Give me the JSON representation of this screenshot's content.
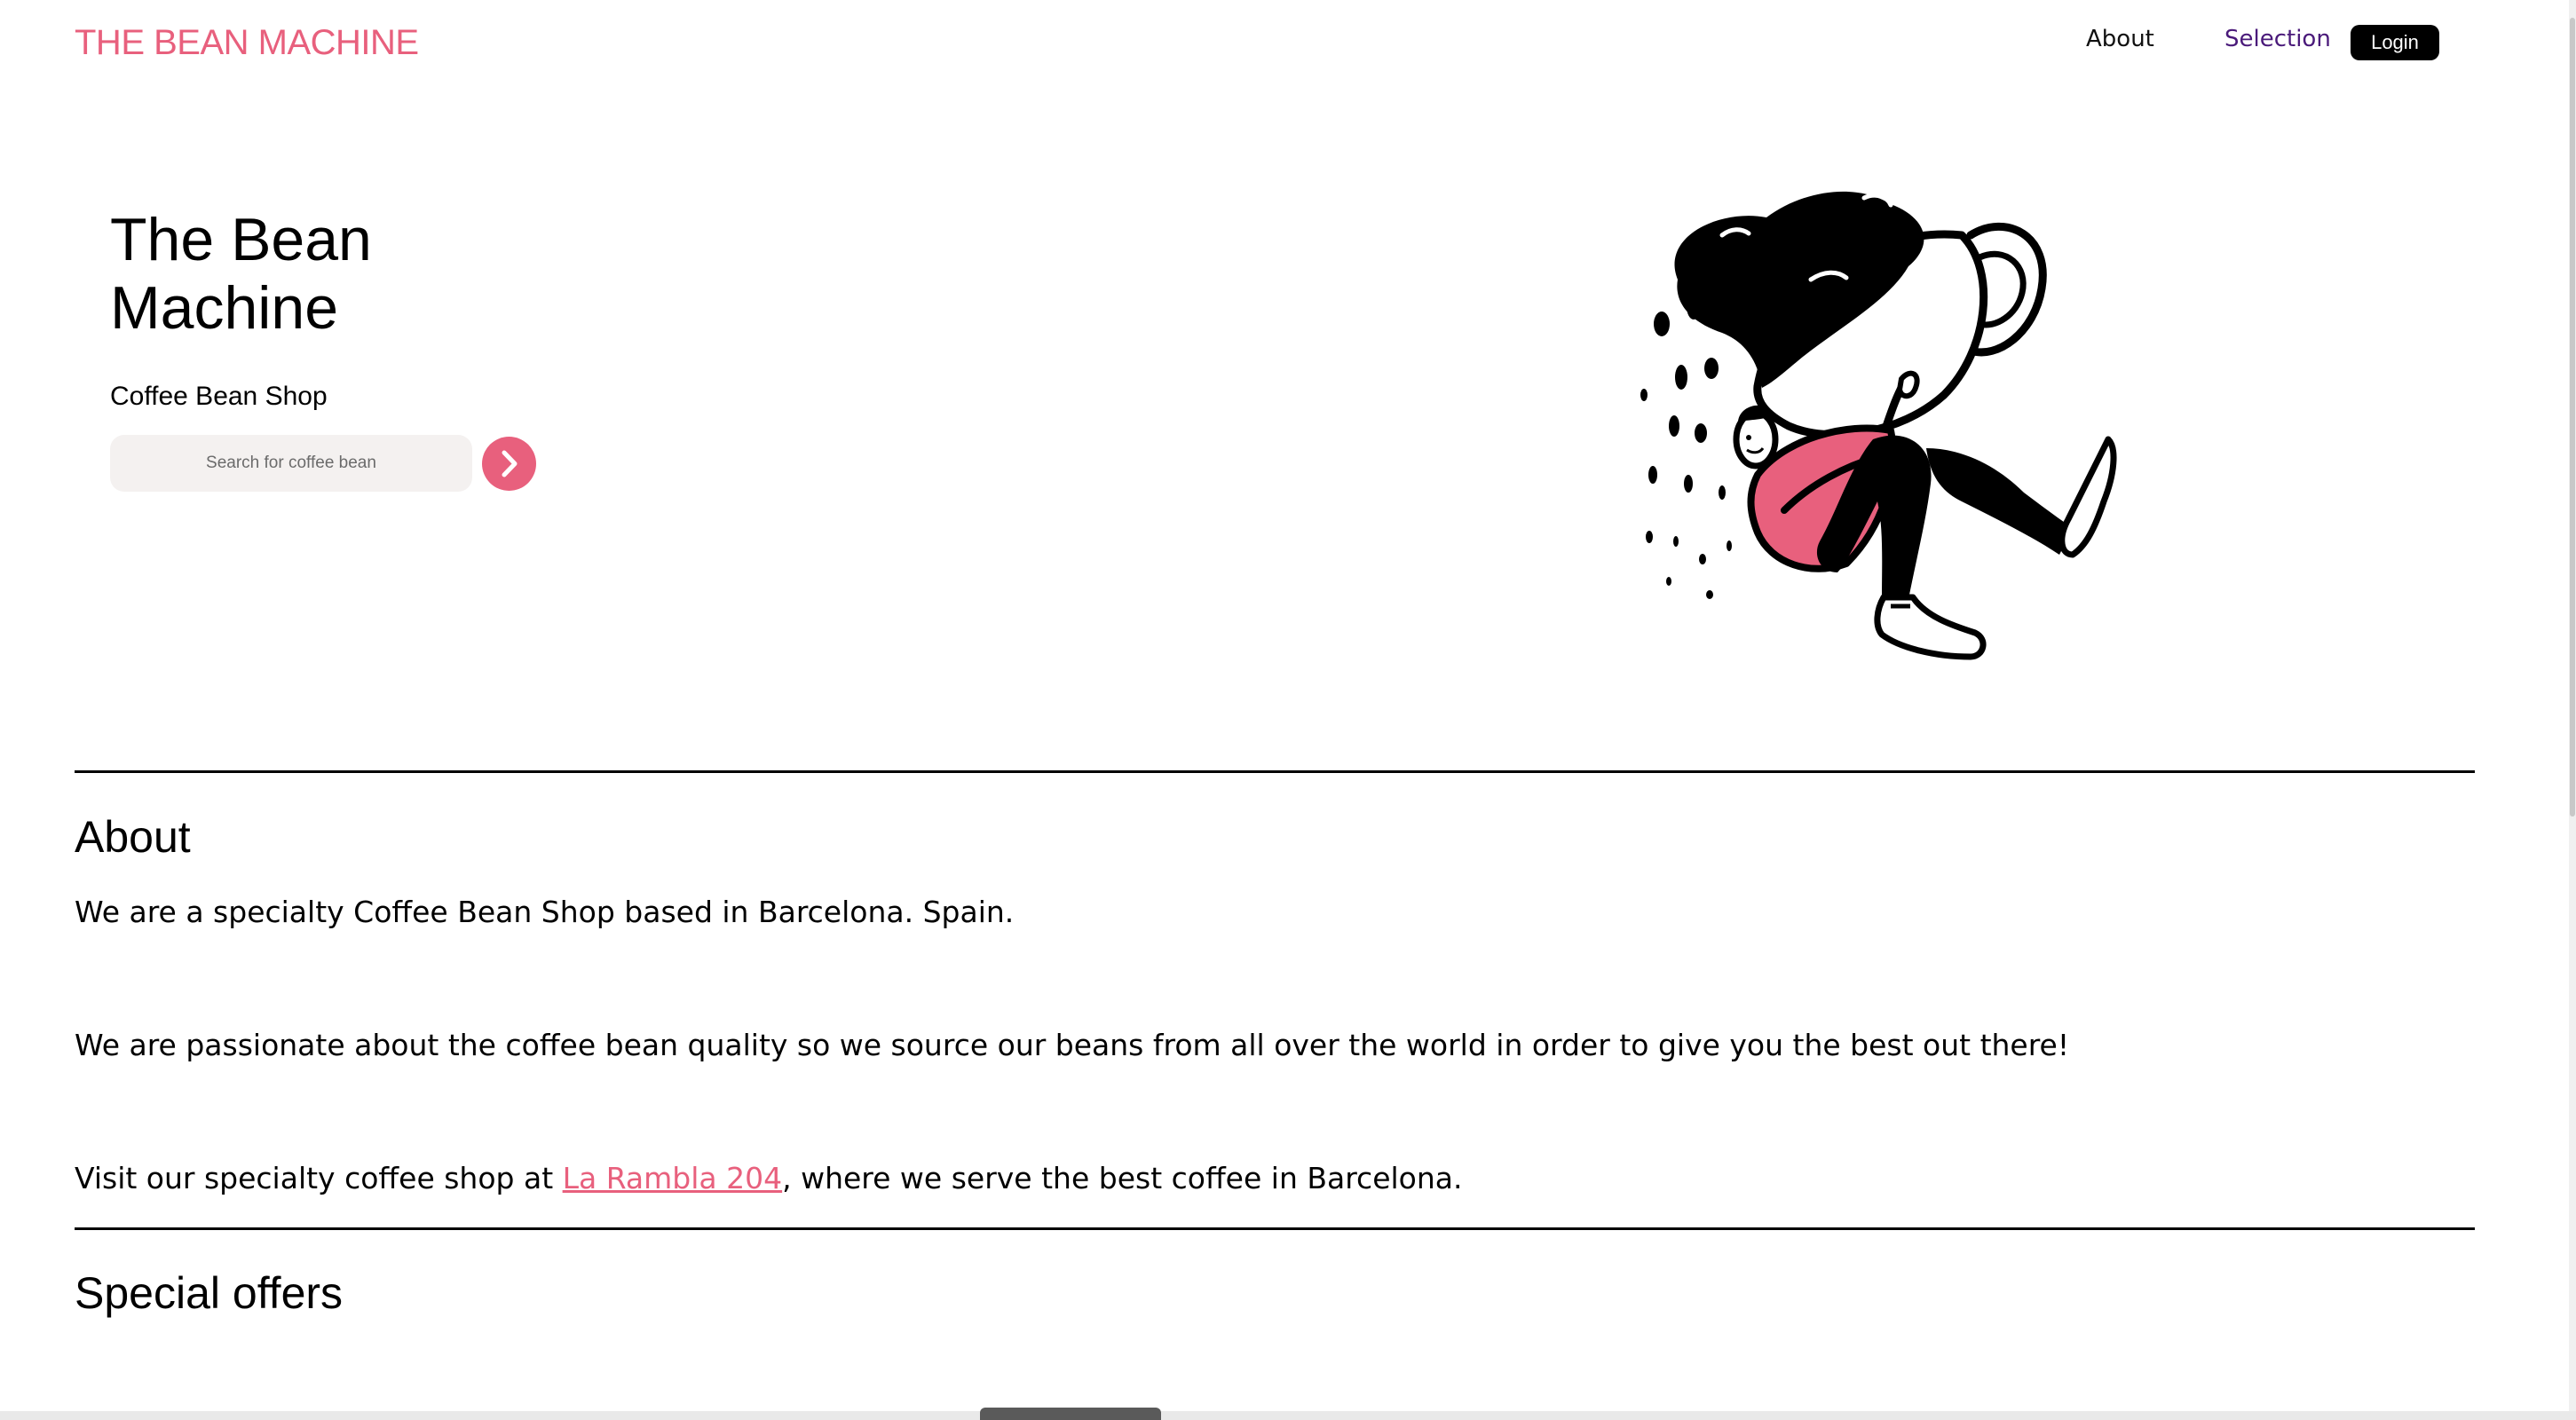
{
  "header": {
    "logo": "THE BEAN MACHINE",
    "nav": {
      "about": "About",
      "selection": "Selection",
      "login": "Login"
    }
  },
  "hero": {
    "title": "The Bean Machine",
    "subtitle": "Coffee Bean Shop",
    "search": {
      "placeholder": "Search for coffee bean",
      "value": ""
    }
  },
  "about": {
    "heading": "About",
    "paragraph1": "We are a specialty Coffee Bean Shop based in Barcelona. Spain.",
    "paragraph2": "We are passionate about the coffee bean quality so we source our beans from all over the world in order to give you the best out there!",
    "paragraph3_before": "Visit our specialty coffee shop at ",
    "address_link": "La Rambla 204",
    "paragraph3_after": ", where we serve the best coffee in Barcelona."
  },
  "special_offers": {
    "heading": "Special offers"
  },
  "icons": {
    "search_button": "chevron-right-icon",
    "illustration": "coffee-cup-person-illustration"
  },
  "colors": {
    "brand": "#e8607d",
    "selection_link": "#4a1a7a",
    "search_bg": "#f4f1f0",
    "login_bg": "#000000"
  }
}
